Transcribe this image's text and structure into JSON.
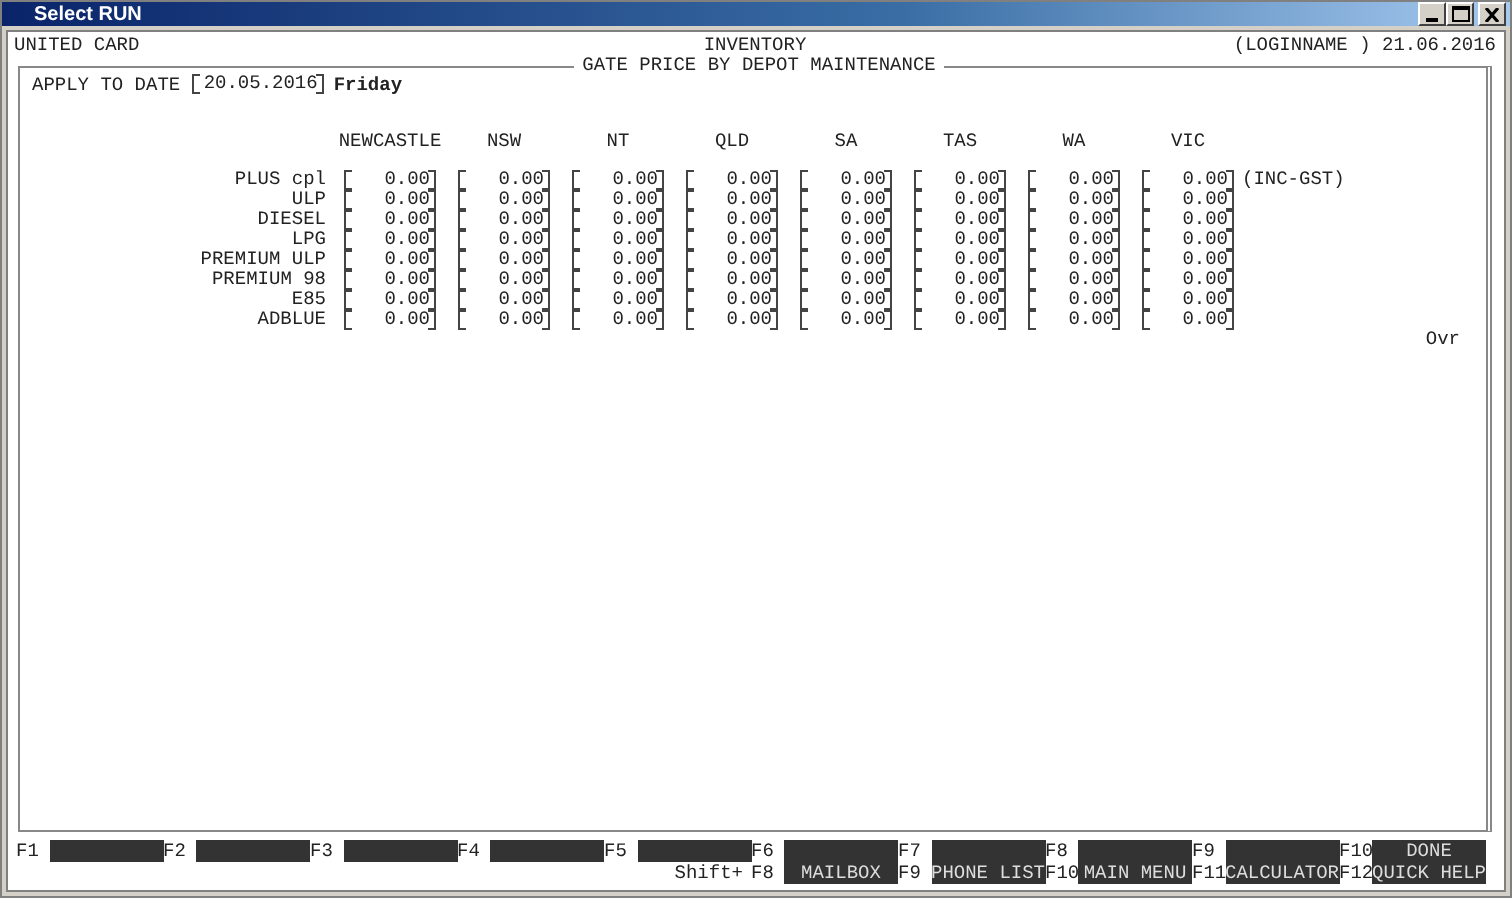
{
  "window": {
    "title": "Select RUN"
  },
  "header": {
    "company": "UNITED CARD",
    "module": "INVENTORY",
    "user": "(LOGINNAME )",
    "date": "21.06.2016"
  },
  "form": {
    "title": "GATE PRICE BY DEPOT MAINTENANCE",
    "apply_label": "APPLY TO DATE",
    "apply_date": "20.05.2016",
    "weekday": "Friday",
    "columns": [
      "NEWCASTLE",
      "NSW",
      "NT",
      "QLD",
      "SA",
      "TAS",
      "WA",
      "VIC"
    ],
    "rows": [
      {
        "product": "PLUS cpl",
        "prices": [
          "0.00",
          "0.00",
          "0.00",
          "0.00",
          "0.00",
          "0.00",
          "0.00",
          "0.00"
        ],
        "note": "(INC-GST)"
      },
      {
        "product": "ULP",
        "prices": [
          "0.00",
          "0.00",
          "0.00",
          "0.00",
          "0.00",
          "0.00",
          "0.00",
          "0.00"
        ]
      },
      {
        "product": "DIESEL",
        "prices": [
          "0.00",
          "0.00",
          "0.00",
          "0.00",
          "0.00",
          "0.00",
          "0.00",
          "0.00"
        ]
      },
      {
        "product": "LPG",
        "prices": [
          "0.00",
          "0.00",
          "0.00",
          "0.00",
          "0.00",
          "0.00",
          "0.00",
          "0.00"
        ]
      },
      {
        "product": "PREMIUM ULP",
        "prices": [
          "0.00",
          "0.00",
          "0.00",
          "0.00",
          "0.00",
          "0.00",
          "0.00",
          "0.00"
        ]
      },
      {
        "product": "PREMIUM 98",
        "prices": [
          "0.00",
          "0.00",
          "0.00",
          "0.00",
          "0.00",
          "0.00",
          "0.00",
          "0.00"
        ]
      },
      {
        "product": "E85",
        "prices": [
          "0.00",
          "0.00",
          "0.00",
          "0.00",
          "0.00",
          "0.00",
          "0.00",
          "0.00"
        ]
      },
      {
        "product": "ADBLUE",
        "prices": [
          "0.00",
          "0.00",
          "0.00",
          "0.00",
          "0.00",
          "0.00",
          "0.00",
          "0.00"
        ]
      }
    ],
    "mode": "Ovr"
  },
  "function_keys": {
    "shift_prefix": "Shift+",
    "keys": [
      {
        "key": "F1"
      },
      {
        "key": "F2"
      },
      {
        "key": "F3"
      },
      {
        "key": "F4"
      },
      {
        "key": "F5"
      },
      {
        "key": "F6",
        "shift_key": "F8",
        "shift_label": "MAILBOX"
      },
      {
        "key": "F7",
        "shift_key": "F9",
        "shift_label": "PHONE LIST"
      },
      {
        "key": "F8",
        "shift_key": "F10",
        "shift_label": "MAIN MENU"
      },
      {
        "key": "F9",
        "shift_key": "F11",
        "shift_label": "CALCULATOR"
      },
      {
        "key": "F10",
        "label": "DONE",
        "shift_key": "F12",
        "shift_label": "QUICK HELP"
      }
    ]
  }
}
